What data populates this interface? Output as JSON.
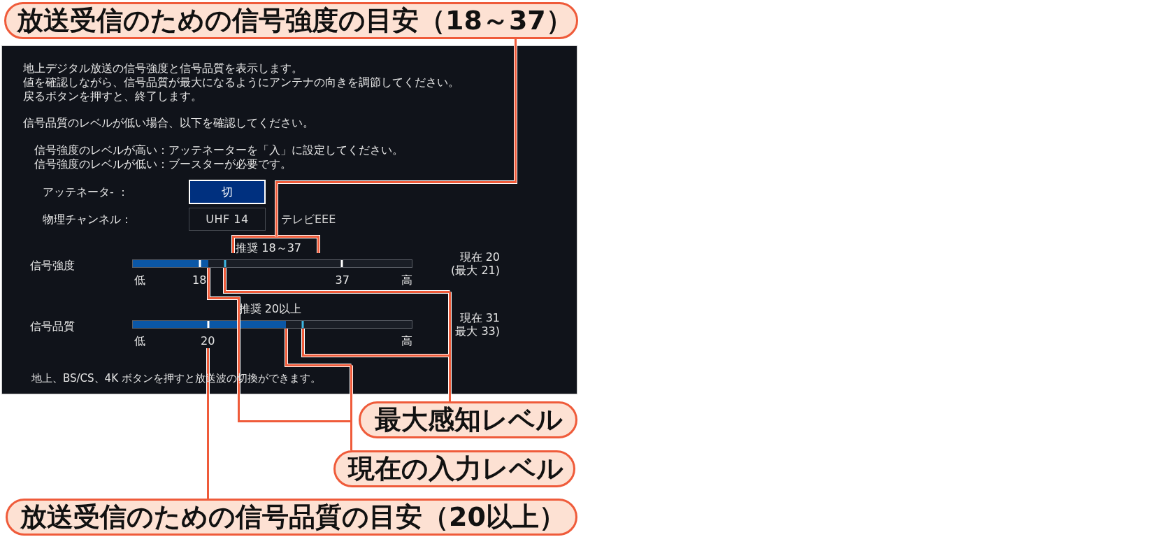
{
  "top_callout": {
    "kind": "strength_guide",
    "text": "放送受信のための信号強度の目安（18～37）"
  },
  "screen": {
    "intro": [
      "地上デジタル放送の信号強度と信号品質を表示します。",
      "値を確認しながら、信号品質が最大になるようにアンテナの向きを調節してください。",
      "戻るボタンを押すと、終了します。"
    ],
    "check_heading": "信号品質のレベルが低い場合、以下を確認してください。",
    "check_items": [
      "信号強度のレベルが高い：アッテネーターを「入」に設定してください。",
      "信号強度のレベルが低い：ブースターが必要です。"
    ],
    "settings": [
      {
        "label": "アッテネータ- ：",
        "value": "切",
        "selected": true
      },
      {
        "label": "物理チャンネル：",
        "value": "UHF 14",
        "selected": false,
        "note": "テレビEEE"
      }
    ],
    "meters": [
      {
        "label": "信号強度",
        "recommended": "推奨 18～37",
        "level": 0.27,
        "markers": [
          {
            "kind": "threshold",
            "level": 0.24,
            "label": "18"
          },
          {
            "kind": "threshold",
            "level": 0.75,
            "label": "37"
          },
          {
            "kind": "peak",
            "level": 0.33
          }
        ],
        "scale_low": "低",
        "scale_high": "高",
        "current": "現在 20",
        "peak": "(最大 21)"
      },
      {
        "label": "信号品質",
        "recommended": "推奨 20以上",
        "level": 0.55,
        "markers": [
          {
            "kind": "threshold",
            "level": 0.27,
            "label": "20"
          },
          {
            "kind": "peak",
            "level": 0.61
          }
        ],
        "scale_low": "低",
        "scale_high": "高",
        "current": "現在 31",
        "peak": "最大 33)"
      }
    ],
    "footer": "地上、BS/CS、4K ボタンを押すと放送波の切換ができます。"
  },
  "bottom_callouts": [
    {
      "kind": "peak",
      "text": "最大感知レベル"
    },
    {
      "kind": "current",
      "text": "現在の入力レベル"
    },
    {
      "kind": "quality_guide",
      "text": "放送受信のための信号品質の目安（20以上）"
    }
  ]
}
